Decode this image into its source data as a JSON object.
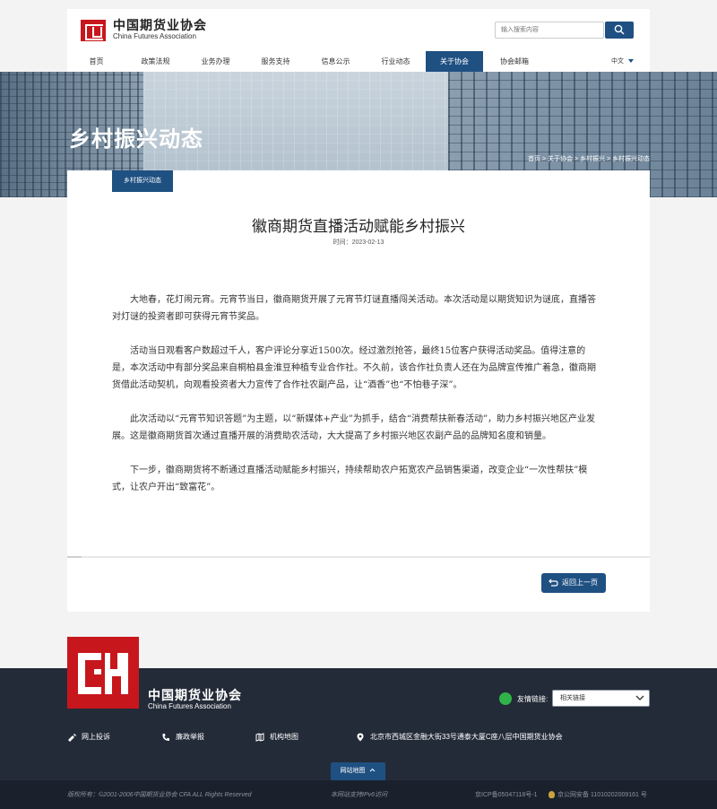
{
  "header": {
    "logo_cn": "中国期货业协会",
    "logo_en": "China Futures Association",
    "search_placeholder": "输入搜索内容",
    "lang": "中文"
  },
  "nav": [
    {
      "label": "首页",
      "active": false
    },
    {
      "label": "政策法规",
      "active": false
    },
    {
      "label": "业务办理",
      "active": false
    },
    {
      "label": "服务支持",
      "active": false
    },
    {
      "label": "信息公示",
      "active": false
    },
    {
      "label": "行业动态",
      "active": false
    },
    {
      "label": "关于协会",
      "active": true
    },
    {
      "label": "协会邮箱",
      "active": false
    }
  ],
  "banner": {
    "title": "乡村振兴动态",
    "breadcrumb": "首页 > 关于协会 > 乡村振兴 > 乡村振兴动态"
  },
  "article": {
    "tab": "乡村振兴动态",
    "title": "徽商期货直播活动赋能乡村振兴",
    "date": "时间：2023-02-13",
    "paragraphs": [
      "大地春，花灯闹元宵。元宵节当日，徽商期货开展了元宵节灯谜直播闯关活动。本次活动是以期货知识为谜底，直播答对灯谜的投资者即可获得元宵节奖品。",
      "活动当日观看客户数超过千人，客户评论分享近1500次。经过激烈抢答，最终15位客户获得活动奖品。值得注意的是，本次活动中有部分奖品来自桐柏县金淮豆种植专业合作社。不久前，该合作社负责人还在为品牌宣传推广着急，徽商期货借此活动契机，向观看投资者大力宣传了合作社农副产品，让“酒香”也“不怕巷子深”。",
      "此次活动以“元宵节知识答题”为主题，以“新媒体+产业”为抓手，结合“消费帮扶新春活动”，助力乡村振兴地区产业发展。这是徽商期货首次通过直播开展的消费助农活动，大大提高了乡村振兴地区农副产品的品牌知名度和销量。",
      "下一步，徽商期货将不断通过直播活动赋能乡村振兴，持续帮助农户拓宽农产品销售渠道，改变企业“一次性帮扶”模式，让农户开出“致富花”。"
    ],
    "back_label": "返回上一页"
  },
  "footer": {
    "logo_cn": "中国期货业协会",
    "logo_en": "China Futures Association",
    "friend_label": "友情链接:",
    "friend_select": "相关链接",
    "links": [
      {
        "label": "网上投诉",
        "icon": "pen-icon"
      },
      {
        "label": "廉政举报",
        "icon": "phone-icon"
      },
      {
        "label": "机构地图",
        "icon": "map-icon"
      },
      {
        "label": "北京市西城区金融大街33号通泰大厦C座八层中国期货业协会",
        "icon": "location-icon"
      }
    ],
    "sitemap": "网站地图",
    "copyright": "版权所有：©2001-2006中国期货业协会 CFA ALL Rights Reserved",
    "ipv6": "本网站支持IPv6访问",
    "icp": "京ICP备05047118号-1",
    "police": "京公网安备 11010202009161 号"
  },
  "colors": {
    "primary": "#1f5082",
    "brand_red": "#c8161d",
    "footer_bg": "#242b38"
  }
}
